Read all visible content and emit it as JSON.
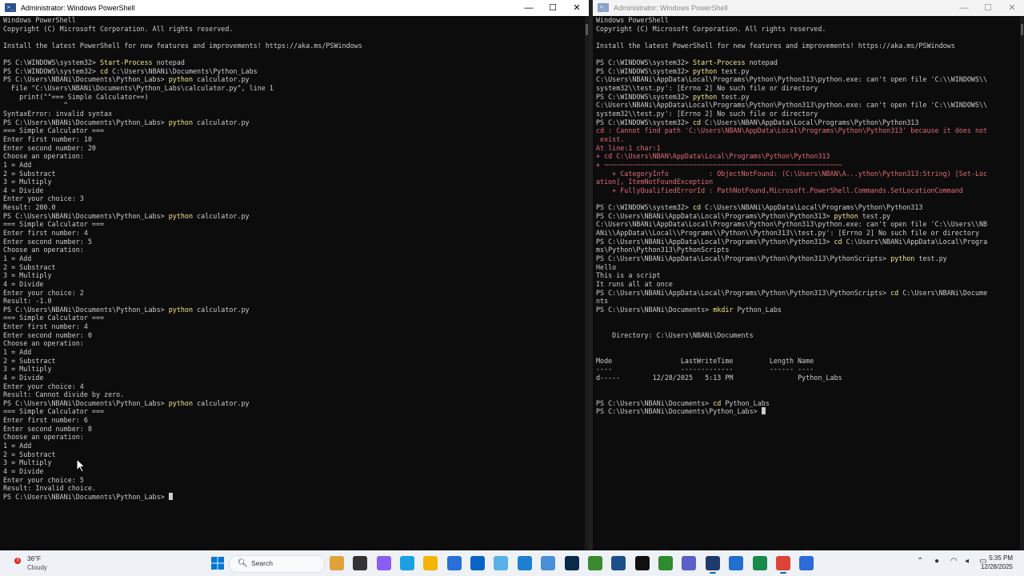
{
  "left_window": {
    "title": "Administrator: Windows PowerShell",
    "lines": [
      [
        {
          "t": "Windows PowerShell"
        }
      ],
      [
        {
          "t": "Copyright (C) Microsoft Corporation. All rights reserved."
        }
      ],
      [
        {
          "t": ""
        }
      ],
      [
        {
          "t": "Install the latest PowerShell for new features and improvements! https://aka.ms/PSWindows"
        }
      ],
      [
        {
          "t": ""
        }
      ],
      [
        {
          "t": "PS C:\\WINDOWS\\system32> "
        },
        {
          "t": "Start-Process",
          "c": "cmd"
        },
        {
          "t": " notepad"
        }
      ],
      [
        {
          "t": "PS C:\\WINDOWS\\system32> "
        },
        {
          "t": "cd",
          "c": "cmd"
        },
        {
          "t": " C:\\Users\\NBANi\\Documents\\Python_Labs"
        }
      ],
      [
        {
          "t": "PS C:\\Users\\NBANi\\Documents\\Python_Labs> "
        },
        {
          "t": "python",
          "c": "cmd"
        },
        {
          "t": " calculator.py"
        }
      ],
      [
        {
          "t": "  File \"C:\\Users\\NBANi\\Documents\\Python_Labs\\calculator.py\", line 1"
        }
      ],
      [
        {
          "t": "    print(\"\"=== Simple Calculator==)"
        }
      ],
      [
        {
          "t": "               ^"
        }
      ],
      [
        {
          "t": "SyntaxError: invalid syntax"
        }
      ],
      [
        {
          "t": "PS C:\\Users\\NBANi\\Documents\\Python_Labs> "
        },
        {
          "t": "python",
          "c": "cmd"
        },
        {
          "t": " calculator.py"
        }
      ],
      [
        {
          "t": "=== Simple Calculator ==="
        }
      ],
      [
        {
          "t": "Enter first number: 10"
        }
      ],
      [
        {
          "t": "Enter second number: 20"
        }
      ],
      [
        {
          "t": "Choose an operation:"
        }
      ],
      [
        {
          "t": "1 = Add"
        }
      ],
      [
        {
          "t": "2 = Substract"
        }
      ],
      [
        {
          "t": "3 = Multiply"
        }
      ],
      [
        {
          "t": "4 = Divide"
        }
      ],
      [
        {
          "t": "Enter your choice: 3"
        }
      ],
      [
        {
          "t": "Result: 200.0"
        }
      ],
      [
        {
          "t": "PS C:\\Users\\NBANi\\Documents\\Python_Labs> "
        },
        {
          "t": "python",
          "c": "cmd"
        },
        {
          "t": " calculator.py"
        }
      ],
      [
        {
          "t": "=== Simple Calculator ==="
        }
      ],
      [
        {
          "t": "Enter first number: 4"
        }
      ],
      [
        {
          "t": "Enter second number: 5"
        }
      ],
      [
        {
          "t": "Choose an operation:"
        }
      ],
      [
        {
          "t": "1 = Add"
        }
      ],
      [
        {
          "t": "2 = Substract"
        }
      ],
      [
        {
          "t": "3 = Multiply"
        }
      ],
      [
        {
          "t": "4 = Divide"
        }
      ],
      [
        {
          "t": "Enter your choice: 2"
        }
      ],
      [
        {
          "t": "Result: -1.0"
        }
      ],
      [
        {
          "t": "PS C:\\Users\\NBANi\\Documents\\Python_Labs> "
        },
        {
          "t": "python",
          "c": "cmd"
        },
        {
          "t": " calculator.py"
        }
      ],
      [
        {
          "t": "=== Simple Calculator ==="
        }
      ],
      [
        {
          "t": "Enter first number: 4"
        }
      ],
      [
        {
          "t": "Enter second number: 0"
        }
      ],
      [
        {
          "t": "Choose an operation:"
        }
      ],
      [
        {
          "t": "1 = Add"
        }
      ],
      [
        {
          "t": "2 = Substract"
        }
      ],
      [
        {
          "t": "3 = Multiply"
        }
      ],
      [
        {
          "t": "4 = Divide"
        }
      ],
      [
        {
          "t": "Enter your choice: 4"
        }
      ],
      [
        {
          "t": "Result: Cannot divide by zero."
        }
      ],
      [
        {
          "t": "PS C:\\Users\\NBANi\\Documents\\Python_Labs> "
        },
        {
          "t": "python",
          "c": "cmd"
        },
        {
          "t": " calculator.py"
        }
      ],
      [
        {
          "t": "=== Simple Calculator ==="
        }
      ],
      [
        {
          "t": "Enter first number: 6"
        }
      ],
      [
        {
          "t": "Enter second number: 8"
        }
      ],
      [
        {
          "t": "Choose an operation:"
        }
      ],
      [
        {
          "t": "1 = Add"
        }
      ],
      [
        {
          "t": "2 = Substract"
        }
      ],
      [
        {
          "t": "3 = Multiply"
        }
      ],
      [
        {
          "t": "4 = Divide"
        }
      ],
      [
        {
          "t": "Enter your choice: 5"
        }
      ],
      [
        {
          "t": "Result: Invalid choice."
        }
      ],
      [
        {
          "t": "PS C:\\Users\\NBANi\\Documents\\Python_Labs> "
        },
        {
          "cursor": true
        }
      ]
    ]
  },
  "right_window": {
    "title": "Administrator: Windows PowerShell",
    "lines": [
      [
        {
          "t": "Windows PowerShell"
        }
      ],
      [
        {
          "t": "Copyright (C) Microsoft Corporation. All rights reserved."
        }
      ],
      [
        {
          "t": ""
        }
      ],
      [
        {
          "t": "Install the latest PowerShell for new features and improvements! https://aka.ms/PSWindows"
        }
      ],
      [
        {
          "t": ""
        }
      ],
      [
        {
          "t": "PS C:\\WINDOWS\\system32> "
        },
        {
          "t": "Start-Process",
          "c": "cmd"
        },
        {
          "t": " notepad"
        }
      ],
      [
        {
          "t": "PS C:\\WINDOWS\\system32> "
        },
        {
          "t": "python",
          "c": "cmd"
        },
        {
          "t": " test.py"
        }
      ],
      [
        {
          "t": "C:\\Users\\NBANi\\AppData\\Local\\Programs\\Python\\Python313\\python.exe: can't open file 'C:\\\\WINDOWS\\\\"
        }
      ],
      [
        {
          "t": "system32\\\\test.py': [Errno 2] No such file or directory"
        }
      ],
      [
        {
          "t": "PS C:\\WINDOWS\\system32> "
        },
        {
          "t": "python",
          "c": "cmd"
        },
        {
          "t": " test.py"
        }
      ],
      [
        {
          "t": "C:\\Users\\NBANi\\AppData\\Local\\Programs\\Python\\Python313\\python.exe: can't open file 'C:\\\\WINDOWS\\\\"
        }
      ],
      [
        {
          "t": "system32\\\\test.py': [Errno 2] No such file or directory"
        }
      ],
      [
        {
          "t": "PS C:\\WINDOWS\\system32> "
        },
        {
          "t": "cd",
          "c": "cmd"
        },
        {
          "t": " C:\\Users\\NBAN\\AppData\\Local\\Programs\\Python\\Python313"
        }
      ],
      [
        {
          "t": "cd : Cannot find path 'C:\\Users\\NBAN\\AppData\\Local\\Programs\\Python\\Python313' because it does not",
          "c": "err"
        }
      ],
      [
        {
          "t": " exist.",
          "c": "err"
        }
      ],
      [
        {
          "t": "At line:1 char:1",
          "c": "err"
        }
      ],
      [
        {
          "t": "+ cd C:\\Users\\NBAN\\AppData\\Local\\Programs\\Python\\Python313",
          "c": "err"
        }
      ],
      [
        {
          "t": "+ ~~~~~~~~~~~~~~~~~~~~~~~~~~~~~~~~~~~~~~~~~~~~~~~~~~~~~~~~~~~",
          "c": "err"
        }
      ],
      [
        {
          "t": "    + CategoryInfo          : ObjectNotFound: (C:\\Users\\NBAN\\A...ython\\Python313:String) [Set-Loc",
          "c": "err"
        }
      ],
      [
        {
          "t": "ation], ItemNotFoundException",
          "c": "err"
        }
      ],
      [
        {
          "t": "    + FullyQualifiedErrorId : PathNotFound,Microsoft.PowerShell.Commands.SetLocationCommand",
          "c": "err"
        }
      ],
      [
        {
          "t": ""
        }
      ],
      [
        {
          "t": "PS C:\\WINDOWS\\system32> "
        },
        {
          "t": "cd",
          "c": "cmd"
        },
        {
          "t": " C:\\Users\\NBANi\\AppData\\Local\\Programs\\Python\\Python313"
        }
      ],
      [
        {
          "t": "PS C:\\Users\\NBANi\\AppData\\Local\\Programs\\Python\\Python313> "
        },
        {
          "t": "python",
          "c": "cmd"
        },
        {
          "t": " test.py"
        }
      ],
      [
        {
          "t": "C:\\Users\\NBANi\\AppData\\Local\\Programs\\Python\\Python313\\python.exe: can't open file 'C:\\\\Users\\\\NB"
        }
      ],
      [
        {
          "t": "ANi\\\\AppData\\\\Local\\\\Programs\\\\Python\\\\Python313\\\\test.py': [Errno 2] No such file or directory"
        }
      ],
      [
        {
          "t": "PS C:\\Users\\NBANi\\AppData\\Local\\Programs\\Python\\Python313> "
        },
        {
          "t": "cd",
          "c": "cmd"
        },
        {
          "t": " C:\\Users\\NBANi\\AppData\\Local\\Progra"
        }
      ],
      [
        {
          "t": "ms\\Python\\Python313\\PythonScripts"
        }
      ],
      [
        {
          "t": "PS C:\\Users\\NBANi\\AppData\\Local\\Programs\\Python\\Python313\\PythonScripts> "
        },
        {
          "t": "python",
          "c": "cmd"
        },
        {
          "t": " test.py"
        }
      ],
      [
        {
          "t": "Hello"
        }
      ],
      [
        {
          "t": "This is a script"
        }
      ],
      [
        {
          "t": "It runs all at once"
        }
      ],
      [
        {
          "t": "PS C:\\Users\\NBANi\\AppData\\Local\\Programs\\Python\\Python313\\PythonScripts> "
        },
        {
          "t": "cd",
          "c": "cmd"
        },
        {
          "t": " C:\\Users\\NBANi\\Docume"
        }
      ],
      [
        {
          "t": "nts"
        }
      ],
      [
        {
          "t": "PS C:\\Users\\NBANi\\Documents> "
        },
        {
          "t": "mkdir",
          "c": "cmd"
        },
        {
          "t": " Python_Labs"
        }
      ],
      [
        {
          "t": ""
        }
      ],
      [
        {
          "t": ""
        }
      ],
      [
        {
          "t": "    Directory: C:\\Users\\NBANi\\Documents"
        }
      ],
      [
        {
          "t": ""
        }
      ],
      [
        {
          "t": ""
        }
      ],
      [
        {
          "t": "Mode                 LastWriteTime         Length Name"
        }
      ],
      [
        {
          "t": "----                 -------------         ------ ----"
        }
      ],
      [
        {
          "t": "d-----        12/28/2025   5:13 PM                Python_Labs"
        }
      ],
      [
        {
          "t": ""
        }
      ],
      [
        {
          "t": ""
        }
      ],
      [
        {
          "t": "PS C:\\Users\\NBANi\\Documents> "
        },
        {
          "t": "cd",
          "c": "cmd"
        },
        {
          "t": " Python_Labs"
        }
      ],
      [
        {
          "t": "PS C:\\Users\\NBANi\\Documents\\Python_Labs> "
        },
        {
          "cursor": true
        }
      ]
    ]
  },
  "window_controls": {
    "minimize": "—",
    "maximize": "☐",
    "close": "✕"
  },
  "taskbar": {
    "weather_temp": "36°F",
    "weather_condition": "Cloudy",
    "weather_badge": "3",
    "search_label": "Search",
    "time": "5:35 PM",
    "date": "12/28/2025",
    "tray_icons": [
      "chevron-up-icon",
      "microphone-icon",
      "network-icon",
      "volume-icon",
      "battery-icon"
    ],
    "apps": [
      {
        "name": "start-icon",
        "color": "#0078d4"
      },
      {
        "name": "widgets-icon",
        "color": "#e0a33b"
      },
      {
        "name": "task-view-icon",
        "color": "#333333"
      },
      {
        "name": "copilot-icon",
        "color": "#8a5cf6"
      },
      {
        "name": "edge-icon",
        "color": "#1ba1e2"
      },
      {
        "name": "file-explorer-icon",
        "color": "#f4b400"
      },
      {
        "name": "store-icon",
        "color": "#2a6fd6"
      },
      {
        "name": "outlook-icon",
        "color": "#0a64c4"
      },
      {
        "name": "notepad-icon",
        "color": "#5ab0e8"
      },
      {
        "name": "vscode-icon",
        "color": "#1e7fd0"
      },
      {
        "name": "remote-desktop-icon",
        "color": "#4a8fd8"
      },
      {
        "name": "photoshop-icon",
        "color": "#0b2a4a"
      },
      {
        "name": "minecraft-icon",
        "color": "#3a8a2e"
      },
      {
        "name": "steam-icon",
        "color": "#1b4f8a"
      },
      {
        "name": "capcut-icon",
        "color": "#111111"
      },
      {
        "name": "xbox-icon",
        "color": "#2e8b2e"
      },
      {
        "name": "teams-icon",
        "color": "#5b5fc7"
      },
      {
        "name": "powershell-icon",
        "color": "#1e3a6e"
      },
      {
        "name": "snipping-tool-icon",
        "color": "#1f6fd1"
      },
      {
        "name": "terminal-icon",
        "color": "#1a8a4a"
      },
      {
        "name": "chrome-icon",
        "color": "#db4437"
      },
      {
        "name": "calculator-icon",
        "color": "#2c6bd8"
      }
    ]
  }
}
